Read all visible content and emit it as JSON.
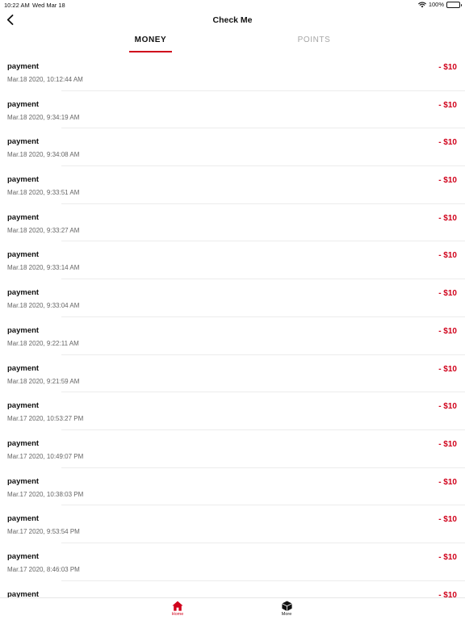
{
  "status": {
    "time": "10:22 AM",
    "date": "Wed Mar 18",
    "battery": "100%"
  },
  "nav": {
    "title": "Check Me"
  },
  "tabs": [
    {
      "label": "MONEY",
      "active": true
    },
    {
      "label": "POINTS",
      "active": false
    }
  ],
  "transactions": [
    {
      "title": "payment",
      "time": "Mar.18 2020, 10:12:44 AM",
      "amount": "- $10"
    },
    {
      "title": "payment",
      "time": "Mar.18 2020, 9:34:19 AM",
      "amount": "- $10"
    },
    {
      "title": "payment",
      "time": "Mar.18 2020, 9:34:08 AM",
      "amount": "- $10"
    },
    {
      "title": "payment",
      "time": "Mar.18 2020, 9:33:51 AM",
      "amount": "- $10"
    },
    {
      "title": "payment",
      "time": "Mar.18 2020, 9:33:27 AM",
      "amount": "- $10"
    },
    {
      "title": "payment",
      "time": "Mar.18 2020, 9:33:14 AM",
      "amount": "- $10"
    },
    {
      "title": "payment",
      "time": "Mar.18 2020, 9:33:04 AM",
      "amount": "- $10"
    },
    {
      "title": "payment",
      "time": "Mar.18 2020, 9:22:11 AM",
      "amount": "- $10"
    },
    {
      "title": "payment",
      "time": "Mar.18 2020, 9:21:59 AM",
      "amount": "- $10"
    },
    {
      "title": "payment",
      "time": "Mar.17 2020, 10:53:27 PM",
      "amount": "- $10"
    },
    {
      "title": "payment",
      "time": "Mar.17 2020, 10:49:07 PM",
      "amount": "- $10"
    },
    {
      "title": "payment",
      "time": "Mar.17 2020, 10:38:03 PM",
      "amount": "- $10"
    },
    {
      "title": "payment",
      "time": "Mar.17 2020, 9:53:54 PM",
      "amount": "- $10"
    },
    {
      "title": "payment",
      "time": "Mar.17 2020, 8:46:03 PM",
      "amount": "- $10"
    },
    {
      "title": "payment",
      "time": "",
      "amount": "- $10"
    }
  ],
  "tabbar": {
    "home": {
      "label": "Home",
      "icon": "home-icon"
    },
    "more": {
      "label": "More",
      "icon": "cube-icon"
    }
  },
  "colors": {
    "accent": "#d0021b",
    "inactive": "#a6a6a6",
    "divider": "#ececec"
  }
}
